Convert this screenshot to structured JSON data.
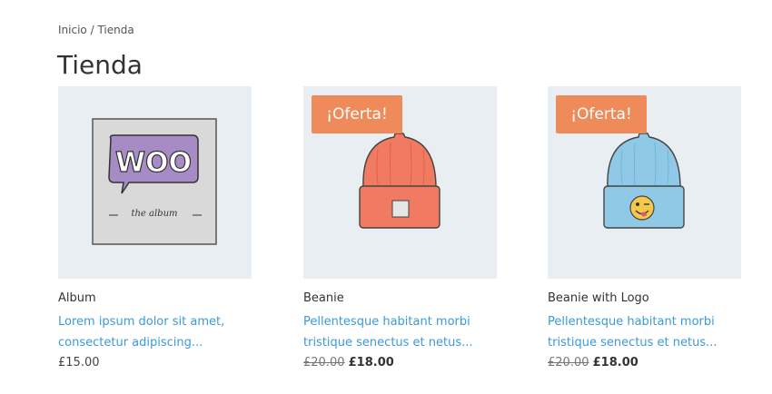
{
  "breadcrumb": {
    "home": "Inicio",
    "separator": " / ",
    "current": "Tienda"
  },
  "page": {
    "title": "Tienda"
  },
  "products": [
    {
      "name": "Album",
      "description_line1": "Lorem ipsum dolor sit amet,",
      "description_line2": "consectetur adipiscing...",
      "price": "£15.00",
      "image_text_main": "WOO",
      "image_text_sub": "the album"
    },
    {
      "name": "Beanie",
      "badge": "¡Oferta!",
      "description_line1": "Pellentesque habitant morbi",
      "description_line2": "tristique senectus et netus...",
      "price_old": "£20.00",
      "price_new": "£18.00"
    },
    {
      "name": "Beanie with Logo",
      "badge": "¡Oferta!",
      "description_line1": "Pellentesque habitant morbi",
      "description_line2": "tristique senectus et netus...",
      "price_old": "£20.00",
      "price_new": "£18.00"
    }
  ],
  "colors": {
    "link": "#3b9ad9",
    "badge": "#ef8a5a",
    "image_bg": "#e8eef2",
    "beanie_orange": "#f07a62",
    "beanie_blue": "#8fc9e6",
    "woo_purple": "#a78bc4"
  }
}
